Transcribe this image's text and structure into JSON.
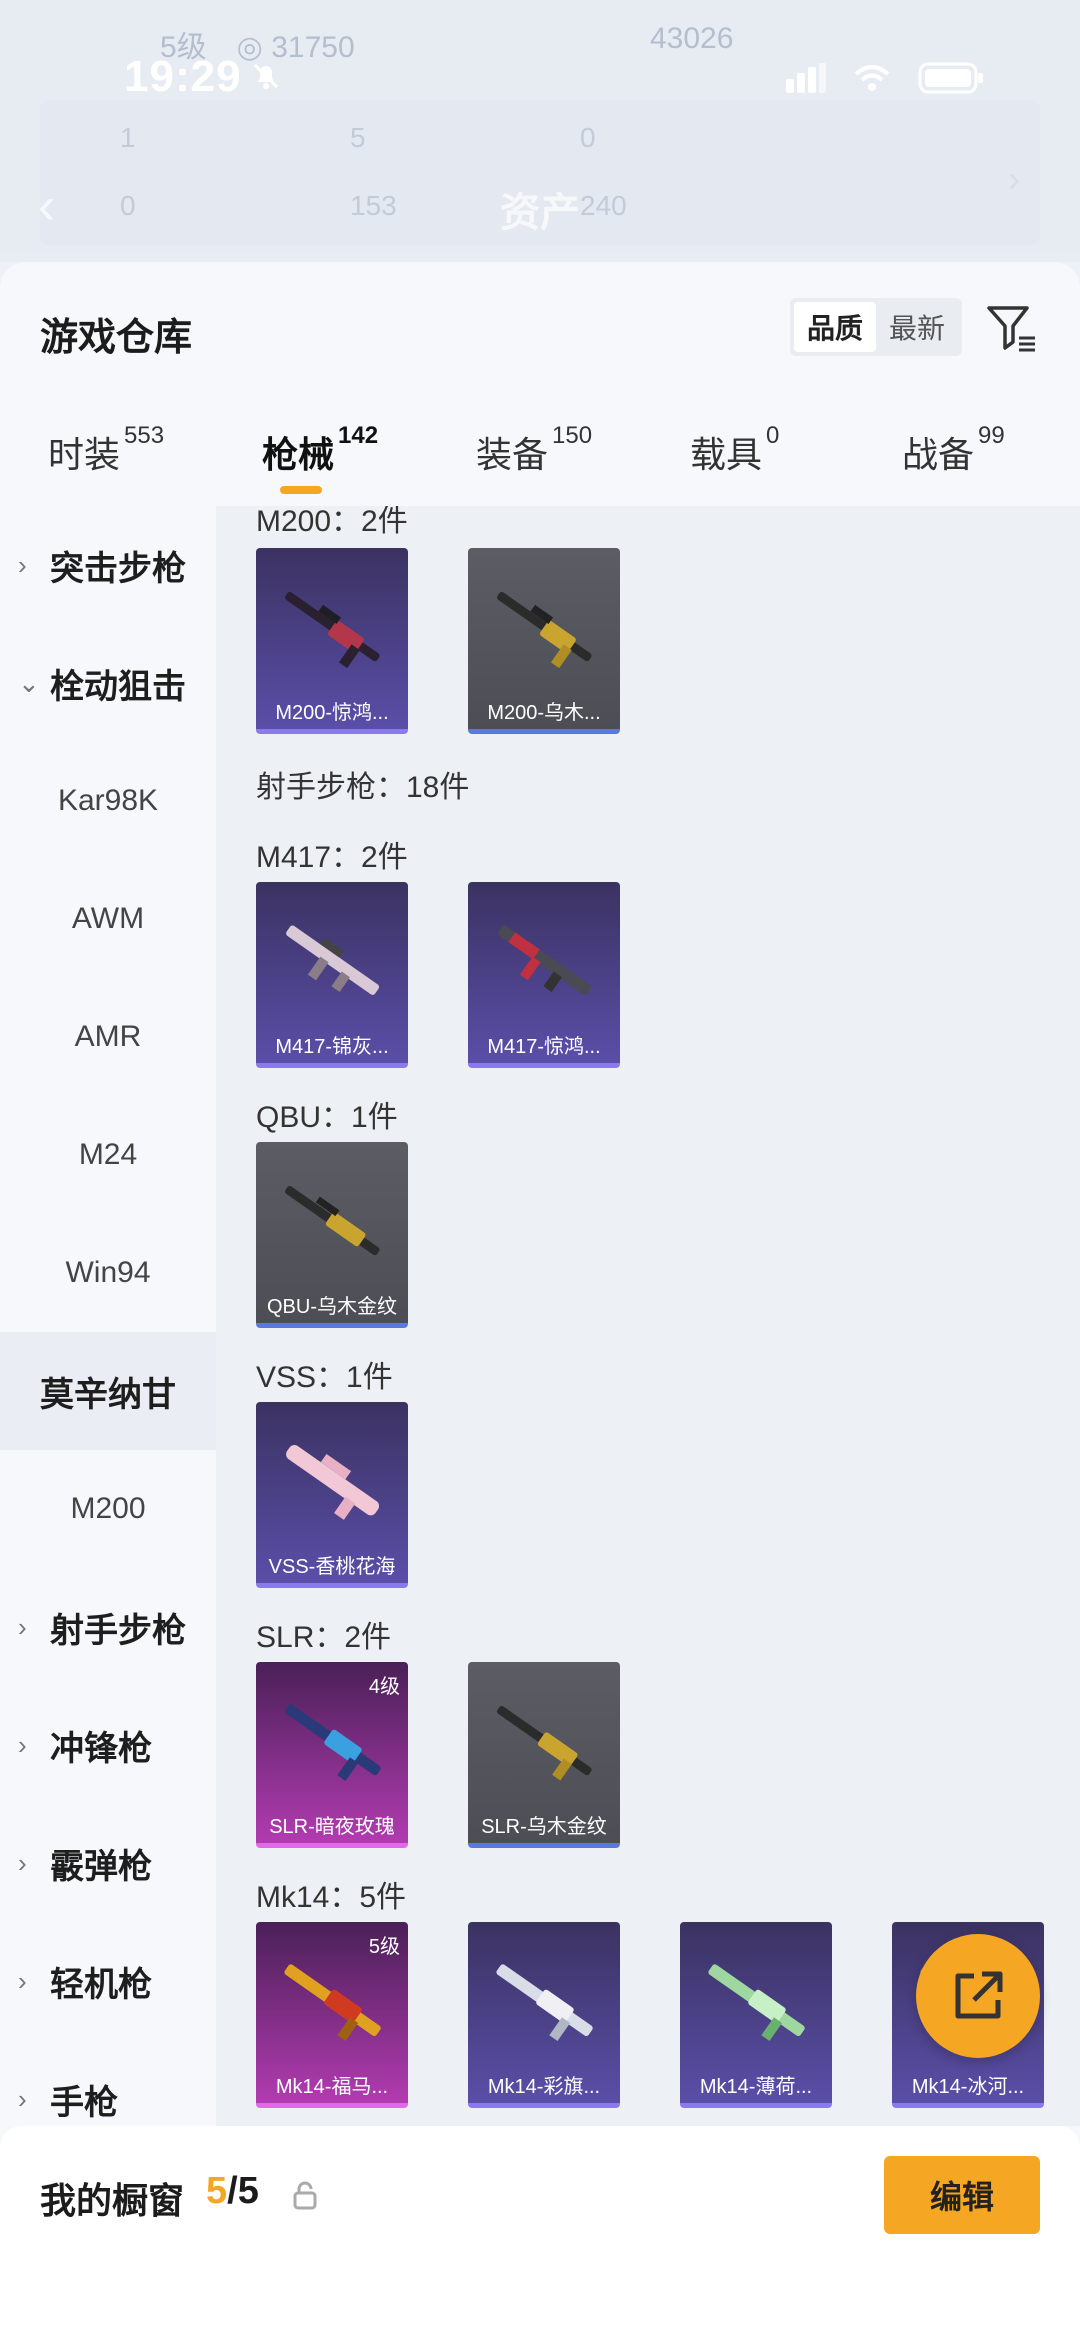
{
  "background": {
    "level": "5级",
    "points": "31750",
    "rank_points": "43026",
    "stats_row1": [
      "1",
      "5",
      "0"
    ],
    "stats_row2": [
      "0",
      "153",
      "240"
    ],
    "assets_label": "资产"
  },
  "status_bar": {
    "time": "19:29"
  },
  "sheet": {
    "title": "游戏仓库",
    "sort": {
      "options": [
        "品质",
        "最新"
      ],
      "selected": "品质"
    }
  },
  "tabs": [
    {
      "label": "时装",
      "count": "553"
    },
    {
      "label": "枪械",
      "count": "142",
      "active": true
    },
    {
      "label": "装备",
      "count": "150"
    },
    {
      "label": "载具",
      "count": "0"
    },
    {
      "label": "战备",
      "count": "99"
    }
  ],
  "sidenav": {
    "assault": "突击步枪",
    "bolt": "栓动狙击",
    "kar98k": "Kar98K",
    "awm": "AWM",
    "amr": "AMR",
    "m24": "M24",
    "win94": "Win94",
    "mosin": "莫辛纳甘",
    "m200": "M200",
    "dmr": "射手步枪",
    "smg": "冲锋枪",
    "shotgun": "霰弹枪",
    "lmg": "轻机枪",
    "pistol": "手枪"
  },
  "content": {
    "m200_label": "M200：2件",
    "dmr_label": "射手步枪：18件",
    "m417_label": "M417：2件",
    "qbu_label": "QBU：1件",
    "vss_label": "VSS：1件",
    "slr_label": "SLR：2件",
    "mk14_label": "Mk14：5件",
    "cards": {
      "m200_1": "M200-惊鸿...",
      "m200_2": "M200-乌木...",
      "m417_1": "M417-锦灰...",
      "m417_2": "M417-惊鸿...",
      "qbu_1": "QBU-乌木金纹",
      "vss_1": "VSS-香桃花海",
      "slr_1": "SLR-暗夜玫瑰",
      "slr_1_level": "4级",
      "slr_2": "SLR-乌木金纹",
      "mk14_1": "Mk14-福马...",
      "mk14_1_level": "5级",
      "mk14_2": "Mk14-彩旗...",
      "mk14_3": "Mk14-薄荷...",
      "mk14_4": "Mk14-冰河..."
    }
  },
  "bottom": {
    "window_label": "我的橱窗",
    "window_current": "5",
    "window_total": "/5",
    "edit_label": "编辑"
  },
  "colors": {
    "accent": "#f5a623",
    "purple_card": "#4b3f8c",
    "gray_card": "#55565c",
    "pink_card": "#9a2f9a"
  }
}
